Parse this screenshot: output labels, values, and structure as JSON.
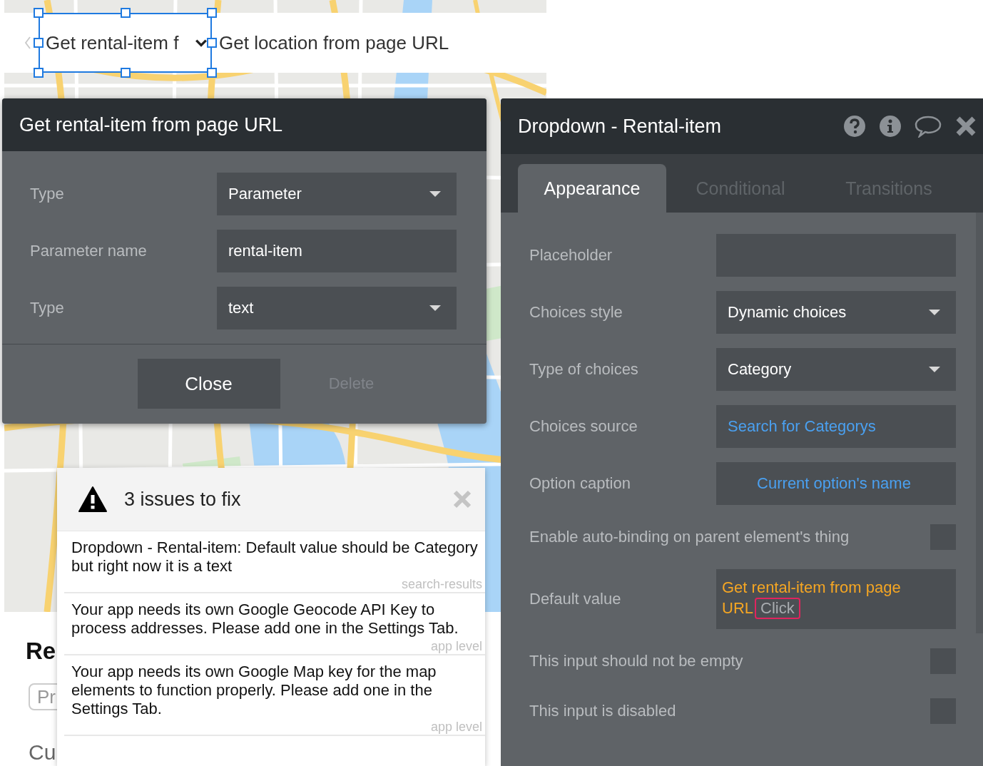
{
  "page": {
    "dropdown": {
      "value": "Get rental-item f",
      "selected": true
    },
    "next_item": "Get location from page URL",
    "heading": "Re",
    "input": {
      "placeholder": "Pr"
    },
    "text": "Cu"
  },
  "expression_popup": {
    "title": "Get rental-item from page URL",
    "fields": [
      {
        "label": "Type",
        "kind": "dropdown",
        "value": "Parameter"
      },
      {
        "label": "Parameter name",
        "kind": "text",
        "value": "rental-item"
      },
      {
        "label": "Type",
        "kind": "dropdown",
        "value": "text"
      }
    ],
    "buttons": [
      {
        "label": "Close",
        "disabled": false
      },
      {
        "label": "Delete",
        "disabled": true
      }
    ]
  },
  "property_editor": {
    "title": "Dropdown - Rental-item",
    "tabs": [
      {
        "label": "Appearance",
        "selected": true
      },
      {
        "label": "Conditional",
        "selected": false
      },
      {
        "label": "Transitions",
        "selected": false
      }
    ],
    "properties": [
      {
        "label": "Placeholder",
        "kind": "input"
      },
      {
        "label": "Choices style",
        "kind": "dropdown",
        "value": "Dynamic choices"
      },
      {
        "label": "Type of choices",
        "kind": "dropdown",
        "value": "Category"
      },
      {
        "label": "Choices source",
        "kind": "link",
        "value": "Search for Categorys"
      },
      {
        "label": "Option caption",
        "kind": "link",
        "value": "Current option's name",
        "centered": true
      },
      {
        "label": "Enable auto-binding on parent element's thing",
        "kind": "checkbox",
        "checked": false
      },
      {
        "label": "Default value",
        "kind": "expression",
        "value": "Get rental-item from page URL",
        "action": "Click"
      },
      {
        "label": "This input should not be empty",
        "kind": "checkbox",
        "checked": false
      },
      {
        "label": "This input is disabled",
        "kind": "checkbox",
        "checked": false
      }
    ]
  },
  "issues": {
    "title": "3 issues to fix",
    "items": [
      {
        "message": "Dropdown - Rental-item: Default value should be Category but right now it is a text",
        "source": "search-results"
      },
      {
        "message": "Your app needs its own Google Geocode API Key to process addresses. Please add one in the Settings Tab.",
        "source": "app level"
      },
      {
        "message": "Your app needs its own Google Map key for the map elements to function properly. Please add one in the Settings Tab.",
        "source": "app level"
      }
    ]
  }
}
